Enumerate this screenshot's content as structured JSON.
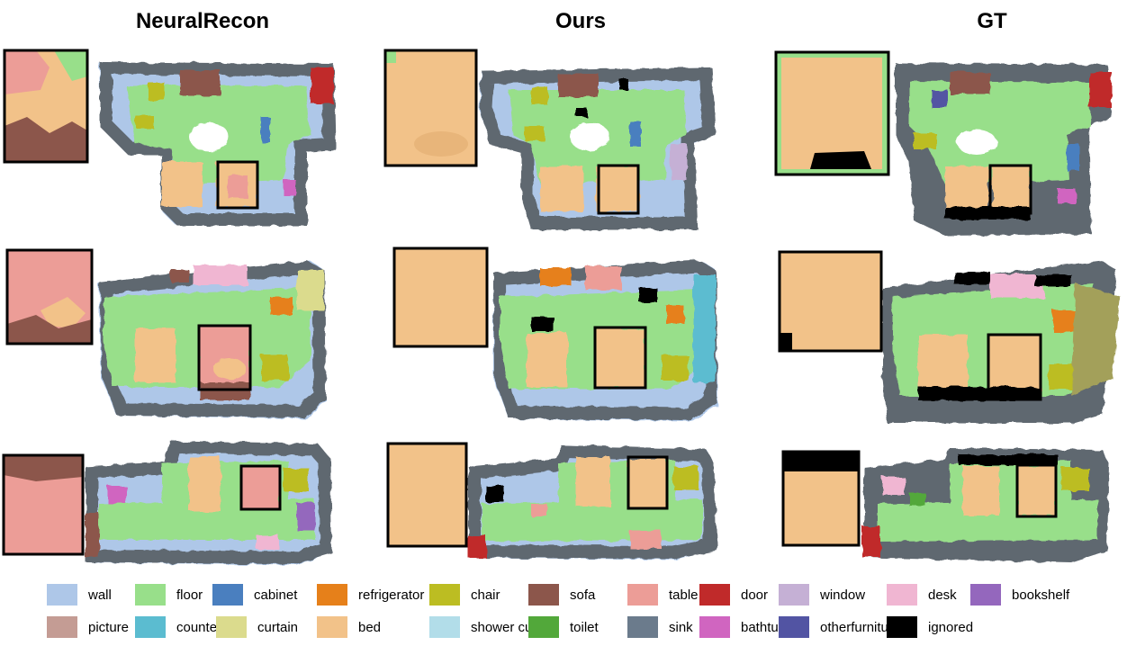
{
  "columns": [
    "NeuralRecon",
    "Ours",
    "GT"
  ],
  "legend": [
    {
      "label": "wall",
      "color": "#aec7e8"
    },
    {
      "label": "floor",
      "color": "#98df8a"
    },
    {
      "label": "cabinet",
      "color": "#4a7fbf"
    },
    {
      "label": "refrigerator",
      "color": "#e6801a"
    },
    {
      "label": "chair",
      "color": "#bcbd22"
    },
    {
      "label": "sofa",
      "color": "#8c564b"
    },
    {
      "label": "table",
      "color": "#ec9d97"
    },
    {
      "label": "door",
      "color": "#c02a2a"
    },
    {
      "label": "window",
      "color": "#c5b0d5"
    },
    {
      "label": "desk",
      "color": "#f0b6d2"
    },
    {
      "label": "bookshelf",
      "color": "#9467bd"
    },
    {
      "label": "picture",
      "color": "#c49c94"
    },
    {
      "label": "counter",
      "color": "#5bbcd0"
    },
    {
      "label": "curtain",
      "color": "#dbdb8d"
    },
    {
      "label": "bed",
      "color": "#f2c289"
    },
    {
      "label": "shower curtain",
      "color": "#b2dde9"
    },
    {
      "label": "toilet",
      "color": "#52a83a"
    },
    {
      "label": "sink",
      "color": "#6b7b8c"
    },
    {
      "label": "bathtub",
      "color": "#d065c0"
    },
    {
      "label": "otherfurniture",
      "color": "#5254a3"
    },
    {
      "label": "ignored",
      "color": "#000000"
    }
  ]
}
